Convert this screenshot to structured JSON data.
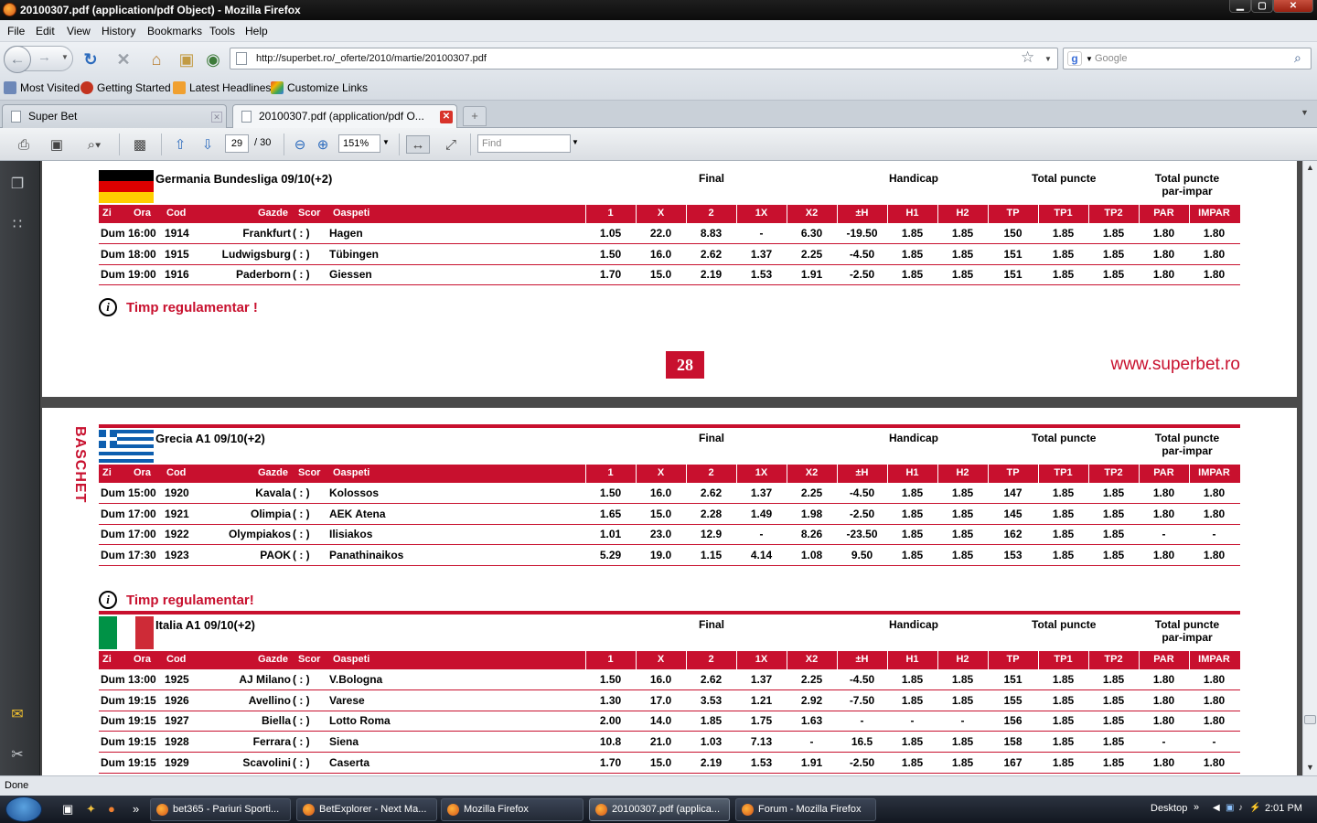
{
  "window": {
    "title": "20100307.pdf (application/pdf Object) - Mozilla Firefox",
    "min": "▁",
    "max": "▢",
    "close": "✕"
  },
  "menu": [
    "File",
    "Edit",
    "View",
    "History",
    "Bookmarks",
    "Tools",
    "Help"
  ],
  "nav": {
    "url": "http://superbet.ro/_oferte/2010/martie/20100307.pdf",
    "search_placeholder": "Google"
  },
  "bookmarks": [
    "Most Visited",
    "Getting Started",
    "Latest Headlines",
    "Customize Links"
  ],
  "tabs": [
    {
      "label": "Super Bet"
    },
    {
      "label": "20100307.pdf (application/pdf O..."
    }
  ],
  "pdf": {
    "page": "29",
    "total": "/ 30",
    "zoom": "151%",
    "find_placeholder": "Find"
  },
  "doc": {
    "page_number": "28",
    "website": "www.superbet.ro",
    "sport": "BASCHET",
    "notice1": "Timp regulamentar !",
    "notice2": "Timp regulamentar!",
    "groups": {
      "final": "Final",
      "handicap": "Handicap",
      "total": "Total puncte",
      "totalpi": "Total puncte par-impar"
    },
    "columns": {
      "zi": "Zi",
      "ora": "Ora",
      "cod": "Cod",
      "gazde": "Gazde",
      "scor": "Scor",
      "oaspeti": "Oaspeti",
      "odds": [
        "1",
        "X",
        "2",
        "1X",
        "X2",
        "±H",
        "H1",
        "H2",
        "TP",
        "TP1",
        "TP2",
        "PAR",
        "IMPAR"
      ]
    },
    "leagues": [
      {
        "name": "Germania Bundesliga 09/10(+2)",
        "rows": [
          {
            "zi": "Dum",
            "ora": "16:00",
            "cod": "1914",
            "gazde": "Frankfurt",
            "scor": "( : )",
            "oaspeti": "Hagen",
            "odds": [
              "1.05",
              "22.0",
              "8.83",
              "-",
              "6.30",
              "-19.50",
              "1.85",
              "1.85",
              "150",
              "1.85",
              "1.85",
              "1.80",
              "1.80"
            ]
          },
          {
            "zi": "Dum",
            "ora": "18:00",
            "cod": "1915",
            "gazde": "Ludwigsburg",
            "scor": "( : )",
            "oaspeti": "Tübingen",
            "odds": [
              "1.50",
              "16.0",
              "2.62",
              "1.37",
              "2.25",
              "-4.50",
              "1.85",
              "1.85",
              "151",
              "1.85",
              "1.85",
              "1.80",
              "1.80"
            ]
          },
          {
            "zi": "Dum",
            "ora": "19:00",
            "cod": "1916",
            "gazde": "Paderborn",
            "scor": "( : )",
            "oaspeti": "Giessen",
            "odds": [
              "1.70",
              "15.0",
              "2.19",
              "1.53",
              "1.91",
              "-2.50",
              "1.85",
              "1.85",
              "151",
              "1.85",
              "1.85",
              "1.80",
              "1.80"
            ]
          }
        ]
      },
      {
        "name": "Grecia A1 09/10(+2)",
        "rows": [
          {
            "zi": "Dum",
            "ora": "15:00",
            "cod": "1920",
            "gazde": "Kavala",
            "scor": "( : )",
            "oaspeti": "Kolossos",
            "odds": [
              "1.50",
              "16.0",
              "2.62",
              "1.37",
              "2.25",
              "-4.50",
              "1.85",
              "1.85",
              "147",
              "1.85",
              "1.85",
              "1.80",
              "1.80"
            ]
          },
          {
            "zi": "Dum",
            "ora": "17:00",
            "cod": "1921",
            "gazde": "Olimpia",
            "scor": "( : )",
            "oaspeti": "AEK Atena",
            "odds": [
              "1.65",
              "15.0",
              "2.28",
              "1.49",
              "1.98",
              "-2.50",
              "1.85",
              "1.85",
              "145",
              "1.85",
              "1.85",
              "1.80",
              "1.80"
            ]
          },
          {
            "zi": "Dum",
            "ora": "17:00",
            "cod": "1922",
            "gazde": "Olympiakos",
            "scor": "( : )",
            "oaspeti": "Ilisiakos",
            "odds": [
              "1.01",
              "23.0",
              "12.9",
              "-",
              "8.26",
              "-23.50",
              "1.85",
              "1.85",
              "162",
              "1.85",
              "1.85",
              "-",
              "-"
            ]
          },
          {
            "zi": "Dum",
            "ora": "17:30",
            "cod": "1923",
            "gazde": "PAOK",
            "scor": "( : )",
            "oaspeti": "Panathinaikos",
            "odds": [
              "5.29",
              "19.0",
              "1.15",
              "4.14",
              "1.08",
              "9.50",
              "1.85",
              "1.85",
              "153",
              "1.85",
              "1.85",
              "1.80",
              "1.80"
            ]
          }
        ]
      },
      {
        "name": "Italia A1 09/10(+2)",
        "rows": [
          {
            "zi": "Dum",
            "ora": "13:00",
            "cod": "1925",
            "gazde": "AJ Milano",
            "scor": "( : )",
            "oaspeti": "V.Bologna",
            "odds": [
              "1.50",
              "16.0",
              "2.62",
              "1.37",
              "2.25",
              "-4.50",
              "1.85",
              "1.85",
              "151",
              "1.85",
              "1.85",
              "1.80",
              "1.80"
            ]
          },
          {
            "zi": "Dum",
            "ora": "19:15",
            "cod": "1926",
            "gazde": "Avellino",
            "scor": "( : )",
            "oaspeti": "Varese",
            "odds": [
              "1.30",
              "17.0",
              "3.53",
              "1.21",
              "2.92",
              "-7.50",
              "1.85",
              "1.85",
              "155",
              "1.85",
              "1.85",
              "1.80",
              "1.80"
            ]
          },
          {
            "zi": "Dum",
            "ora": "19:15",
            "cod": "1927",
            "gazde": "Biella",
            "scor": "( : )",
            "oaspeti": "Lotto Roma",
            "odds": [
              "2.00",
              "14.0",
              "1.85",
              "1.75",
              "1.63",
              "-",
              "-",
              "-",
              "156",
              "1.85",
              "1.85",
              "1.80",
              "1.80"
            ]
          },
          {
            "zi": "Dum",
            "ora": "19:15",
            "cod": "1928",
            "gazde": "Ferrara",
            "scor": "( : )",
            "oaspeti": "Siena",
            "odds": [
              "10.8",
              "21.0",
              "1.03",
              "7.13",
              "-",
              "16.5",
              "1.85",
              "1.85",
              "158",
              "1.85",
              "1.85",
              "-",
              "-"
            ]
          },
          {
            "zi": "Dum",
            "ora": "19:15",
            "cod": "1929",
            "gazde": "Scavolini",
            "scor": "( : )",
            "oaspeti": "Caserta",
            "odds": [
              "1.70",
              "15.0",
              "2.19",
              "1.53",
              "1.91",
              "-2.50",
              "1.85",
              "1.85",
              "167",
              "1.85",
              "1.85",
              "1.80",
              "1.80"
            ]
          }
        ]
      }
    ]
  },
  "status": "Done",
  "taskbar": {
    "tasks": [
      "bet365 - Pariuri Sporti...",
      "BetExplorer - Next Ma...",
      "Mozilla Firefox",
      "20100307.pdf (applica...",
      "Forum - Mozilla Firefox"
    ],
    "desktop": "Desktop",
    "chevron": "»",
    "time": "2:01 PM"
  },
  "colors": {
    "accent": "#c8102e"
  }
}
